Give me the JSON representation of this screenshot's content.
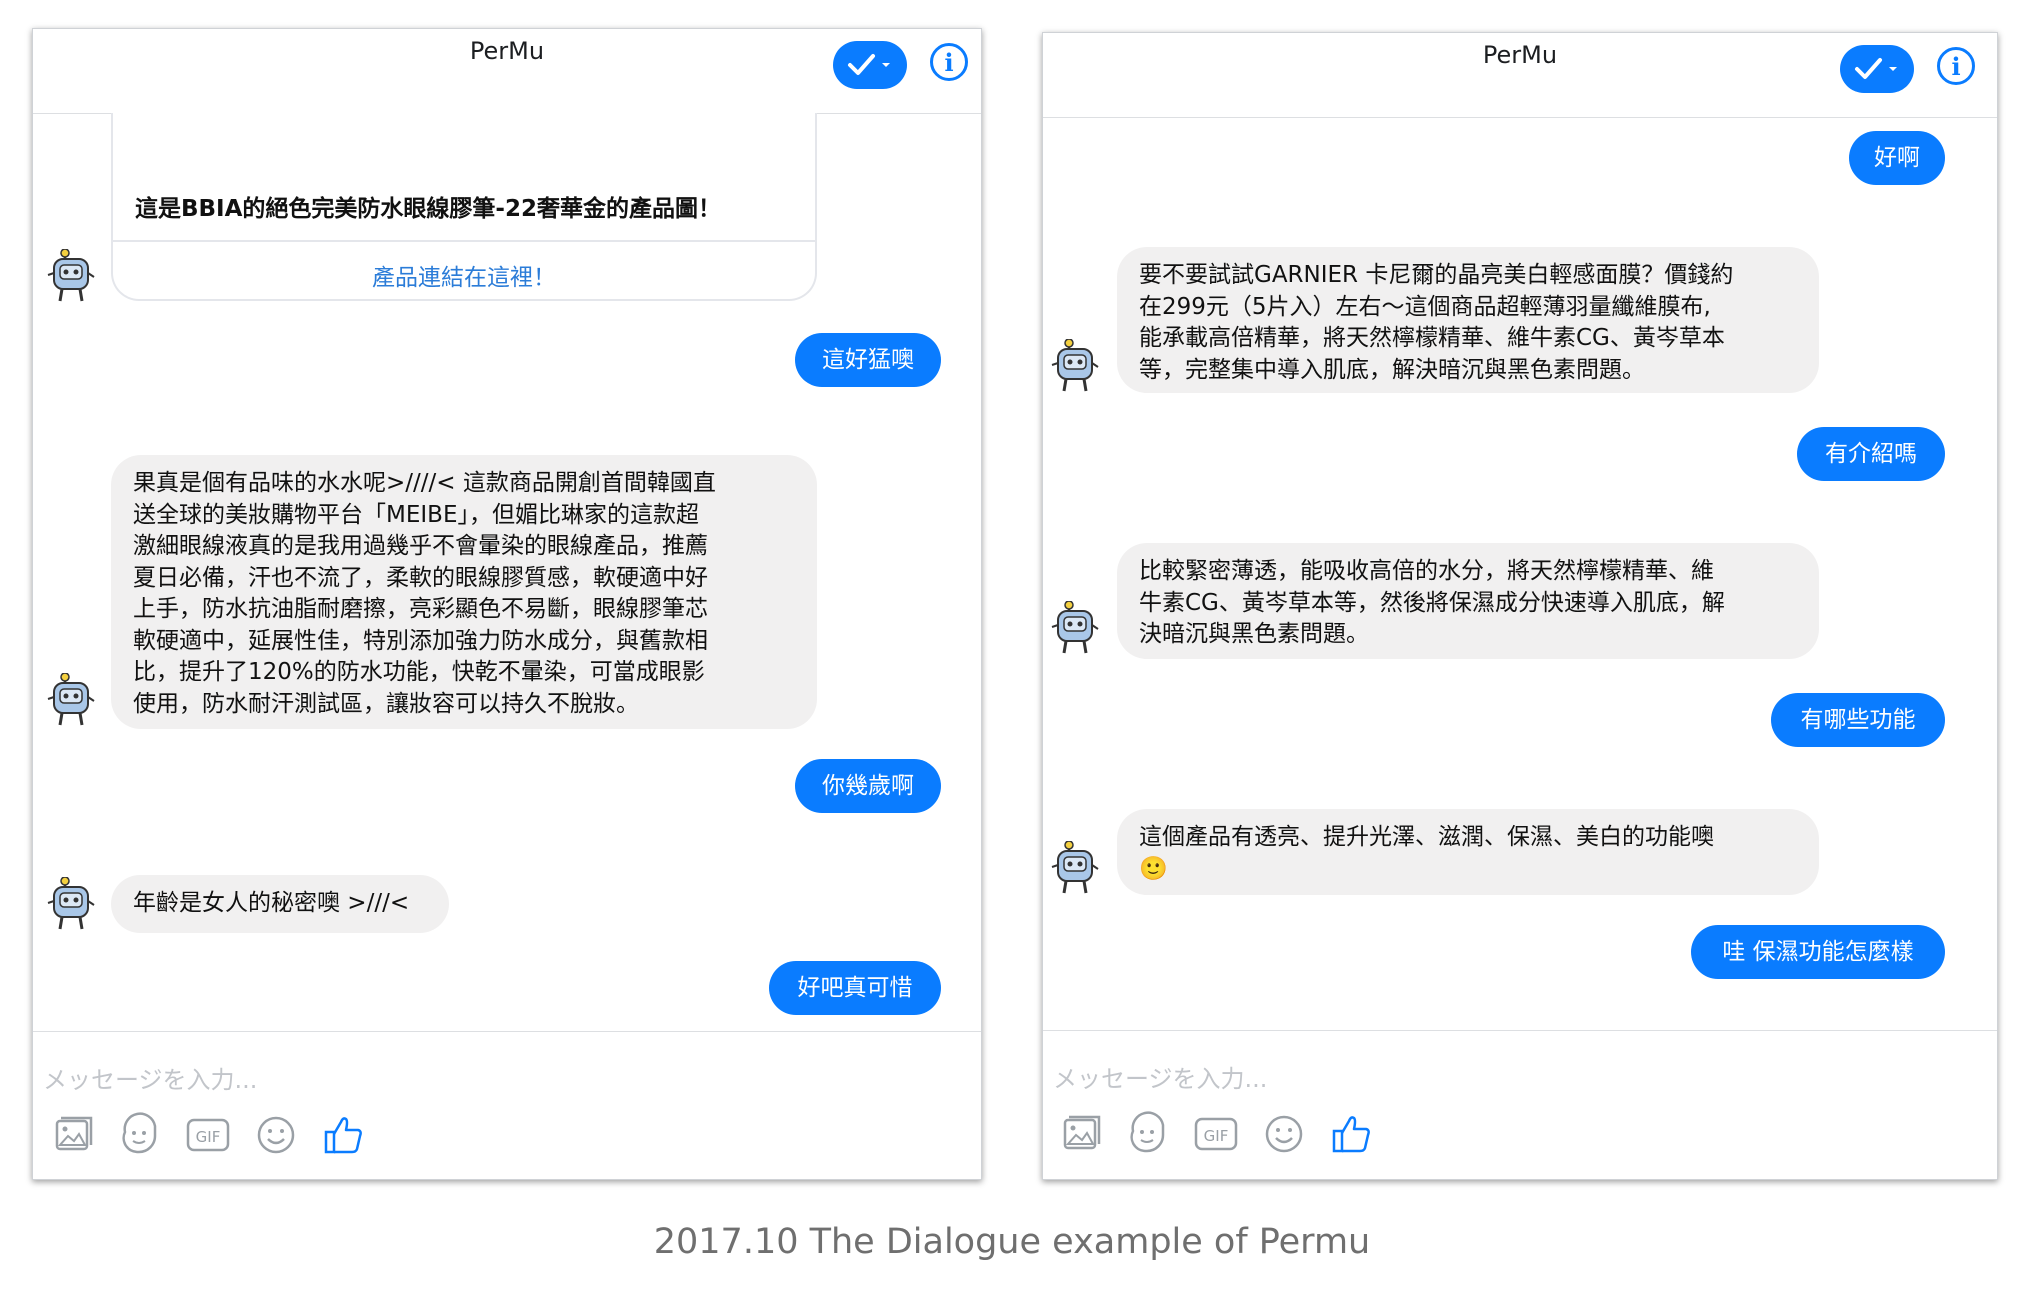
{
  "left_chat": {
    "title": "PerMu",
    "product_card": {
      "title": "這是BBIA的絕色完美防水眼線膠筆-22奢華金的產品圖！",
      "link": "產品連結在這裡！"
    },
    "messages": [
      {
        "from": "user",
        "text": "這好猛噢"
      },
      {
        "from": "bot",
        "lines": [
          "果真是個有品味的水水呢>////< 這款商品開創首間韓國直",
          "送全球的美妝購物平台「MEIBE」，但媚比琳家的這款超",
          "激細眼線液真的是我用過幾乎不會暈染的眼線產品，推薦",
          "夏日必備，汗也不流了，柔軟的眼線膠質感，軟硬適中好",
          "上手，防水抗油脂耐磨擦，亮彩顯色不易斷，眼線膠筆芯",
          "軟硬適中，延展性佳，特別添加強力防水成分，與舊款相",
          "比，提升了120%的防水功能，快乾不暈染，可當成眼影",
          "使用，防水耐汗測試區，讓妝容可以持久不脫妝。"
        ]
      },
      {
        "from": "user",
        "text": "你幾歲啊"
      },
      {
        "from": "bot",
        "lines": [
          "年齡是女人的秘密噢 >///<"
        ]
      },
      {
        "from": "user",
        "text": "好吧真可惜"
      }
    ],
    "composer_placeholder": "メッセージを入力..."
  },
  "right_chat": {
    "title": "PerMu",
    "messages": [
      {
        "from": "user",
        "text": "好啊"
      },
      {
        "from": "bot",
        "lines": [
          "要不要試試GARNIER 卡尼爾的晶亮美白輕感面膜？價錢約",
          "在299元（5片入）左右～這個商品超輕薄羽量纖維膜布,",
          "能承載高倍精華，將天然檸檬精華、維牛素CG、黃岑草本",
          "等，完整集中導入肌底，解決暗沉與黑色素問題。"
        ]
      },
      {
        "from": "user",
        "text": "有介紹嗎"
      },
      {
        "from": "bot",
        "lines": [
          "比較緊密薄透，能吸收高倍的水分，將天然檸檬精華、維",
          "牛素CG、黃岑草本等，然後將保濕成分快速導入肌底，解",
          "決暗沉與黑色素問題。"
        ]
      },
      {
        "from": "user",
        "text": "有哪些功能"
      },
      {
        "from": "bot",
        "lines": [
          "這個產品有透亮、提升光澤、滋潤、保濕、美白的功能噢",
          "🙂"
        ]
      },
      {
        "from": "user",
        "text": "哇 保濕功能怎麼樣"
      }
    ],
    "composer_placeholder": "メッセージを入力..."
  },
  "caption": "2017.10 The Dialogue example of Permu",
  "colors": {
    "accent": "#0a7cff",
    "bubble_in": "#f1f0f0",
    "link": "#2b7cd8"
  },
  "icons": [
    "check-icon",
    "chevron-down-icon",
    "info-icon",
    "photo-icon",
    "sticker-icon",
    "gif-icon",
    "emoji-icon",
    "like-icon",
    "robot-avatar-icon"
  ]
}
